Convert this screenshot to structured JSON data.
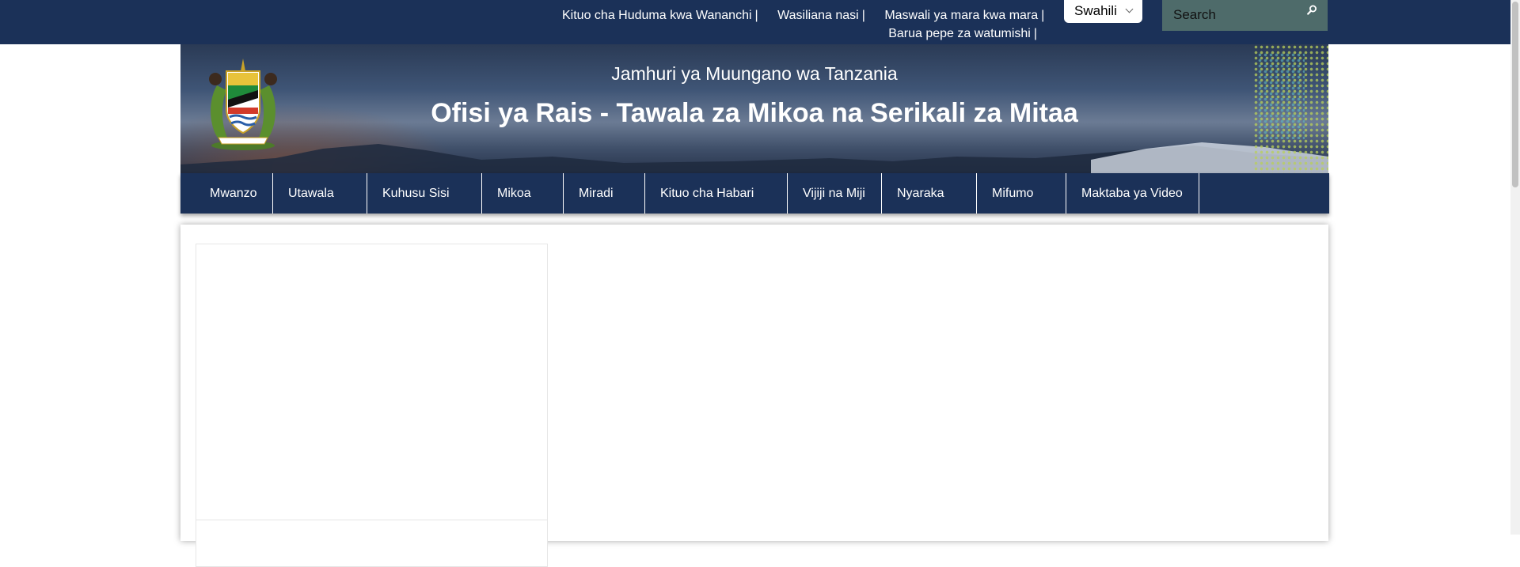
{
  "topbar": {
    "links_row1": [
      {
        "label": "Kituo cha Huduma kwa Wananchi",
        "sep": "|"
      },
      {
        "label": "Wasiliana nasi",
        "sep": "|"
      },
      {
        "label": "Maswali ya mara kwa mara",
        "sep": "|"
      }
    ],
    "links_row2": [
      {
        "label": "Barua pepe za watumishi",
        "sep": "|"
      }
    ],
    "language": {
      "selected": "Swahili"
    },
    "search": {
      "placeholder": "Search"
    }
  },
  "banner": {
    "country": "Jamhuri ya Muungano wa Tanzania",
    "office": "Ofisi ya Rais - Tawala za Mikoa na Serikali za Mitaa"
  },
  "nav": {
    "items": [
      "Mwanzo",
      "Utawala",
      "Kuhusu Sisi",
      "Mikoa",
      "Miradi",
      "Kituo cha Habari",
      "Vijiji na Miji",
      "Nyaraka",
      "Mifumo",
      "Maktaba ya Video"
    ]
  },
  "colors": {
    "primary": "#1b3158",
    "search_bg": "#4e6b6a"
  },
  "icons": {
    "search": "search-icon",
    "language_toggle": "chevron-down-icon",
    "emblem": "coat-of-arms-icon"
  }
}
